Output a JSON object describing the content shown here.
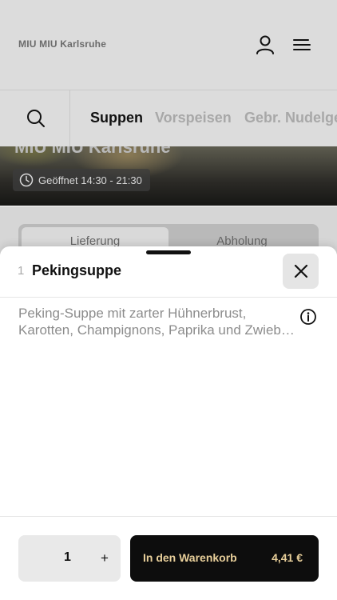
{
  "header": {
    "store_name": "MIU MIU Karlsruhe"
  },
  "categories": [
    {
      "label": "Suppen",
      "active": true
    },
    {
      "label": "Vorspeisen",
      "active": false
    },
    {
      "label": "Gebr. Nudelgerichte",
      "active": false
    }
  ],
  "hero": {
    "title": "MIU MIU Karlsruhe",
    "opening_hours": "Geöffnet 14:30 - 21:30"
  },
  "order_mode": {
    "options": [
      "Lieferung",
      "Abholung"
    ],
    "selected": "Lieferung"
  },
  "product_sheet": {
    "quantity_prefix": "1",
    "name": "Pekingsuppe",
    "description_lines": [
      "Peking-Suppe mit zarter Hühnerbrust,",
      "Karotten, Champignons, Paprika und Zwiebeln"
    ],
    "quantity": "1",
    "plus": "+",
    "add_to_cart_label": "In den Warenkorb",
    "price": "4,41 €"
  },
  "colors": {
    "accent_gold": "#e8cf9a",
    "cart_button_bg": "#0d0d0d",
    "dim_background": "#dcdcdc"
  },
  "icons": [
    "user-icon",
    "menu-icon",
    "search-icon",
    "clock-icon",
    "close-icon",
    "info-icon"
  ]
}
